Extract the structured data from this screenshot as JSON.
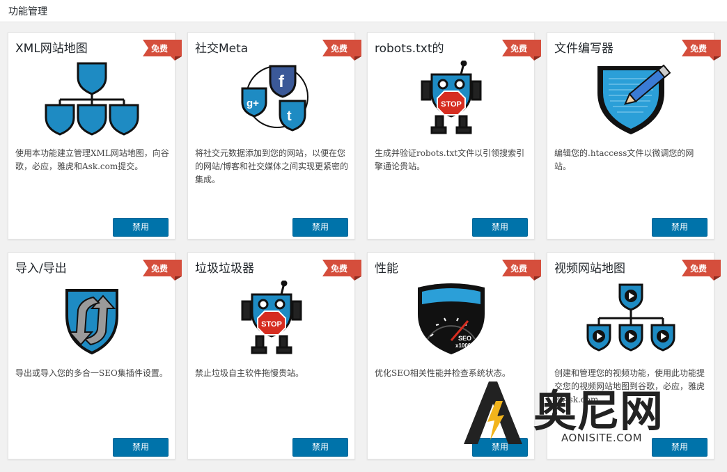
{
  "header": {
    "title": "功能管理"
  },
  "badge_label": "免费",
  "button_label": "禁用",
  "cards": [
    {
      "title": "XML网站地图",
      "icon": "sitemap-shield-icon",
      "description": "使用本功能建立管理XML网站地图，向谷歌，必应，雅虎和Ask.com提交。"
    },
    {
      "title": "社交Meta",
      "icon": "social-shields-icon",
      "description": "将社交元数据添加到您的网站，以便在您的网站/博客和社交媒体之间实现更紧密的集成。"
    },
    {
      "title": "robots.txt的",
      "icon": "robot-stop-icon",
      "description": "生成并验证robots.txt文件以引领搜索引擎通论贵站。"
    },
    {
      "title": "文件编写器",
      "icon": "file-editor-pencil-icon",
      "description": "编辑您的.htaccess文件以微调您的网站。"
    },
    {
      "title": "导入/导出",
      "icon": "import-export-arrows-icon",
      "description": "导出或导入您的多合一SEO集插件设置。"
    },
    {
      "title": "垃圾垃圾器",
      "icon": "bad-bot-stop-icon",
      "description": "禁止垃圾自主软件拖慢贵站。"
    },
    {
      "title": "性能",
      "icon": "speedometer-icon",
      "description": "优化SEO相关性能并检查系统状态。"
    },
    {
      "title": "视频网站地图",
      "icon": "video-sitemap-icon",
      "description": "创建和管理您的视频功能，使用此功能提交您的视频网站地图到谷歌，必应，雅虎和Ask.com。"
    }
  ],
  "speedometer_text": [
    "SEO",
    "x1000"
  ],
  "stop_sign_text": "STOP",
  "watermark": {
    "brand": "奥尼网",
    "domain": "AONISITE.COM"
  },
  "colors": {
    "accent_blue": "#0073aa",
    "badge_red": "#d54e3c",
    "shield_blue": "#1e8bc3"
  }
}
